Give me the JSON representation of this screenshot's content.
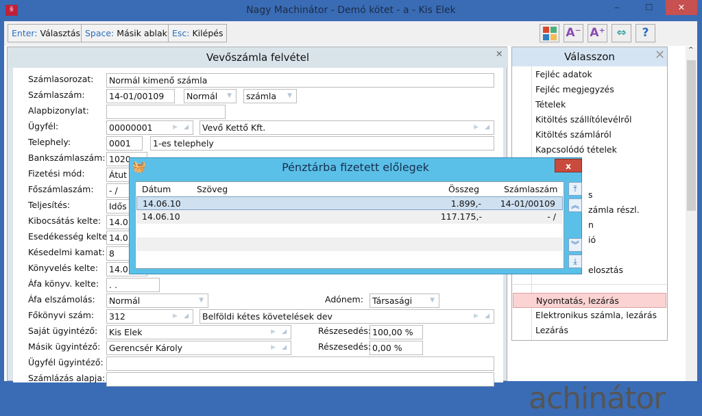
{
  "window": {
    "title": "Nagy Machinátor - Demó kötet - a - Kis Elek",
    "minimize": "‒",
    "maximize": "☐",
    "close": "✕"
  },
  "toolbar": {
    "buttons": [
      {
        "key": "Enter:",
        "label": "Választás"
      },
      {
        "key": "Space:",
        "label": "Másik ablak"
      },
      {
        "key": "Esc:",
        "label": "Kilépés"
      }
    ],
    "icons": [
      "tiles-icon",
      "font-decrease-icon",
      "font-increase-icon",
      "resize-icon",
      "help-icon"
    ],
    "icon_glyphs": [
      "",
      "A⁻",
      "A⁺",
      "⇔",
      "?"
    ]
  },
  "form": {
    "title": "Vevőszámla felvétel",
    "labels": [
      "Számlasorozat:",
      "Számlaszám:",
      "Alapbizonylat:",
      "Ügyfél:",
      "Telephely:",
      "Bankszámlaszám:",
      "Fizetési mód:",
      "Főszámlaszám:",
      "Teljesítés:",
      "Kibocsátás kelte:",
      "Esedékesség kelte:",
      "Késedelmi kamat:",
      "Könyvelés kelte:",
      "Áfa könyv. kelte:",
      "Áfa elszámolás:",
      "Főkönyvi szám:",
      "Saját ügyintéző:",
      "Másik ügyintéző:",
      "Ügyfél ügyintéző:",
      "Számlázás alapja:"
    ],
    "szamlasorozat": "Normál kimenő számla",
    "szamlaszam": "14-01/00109",
    "tipus": "Normál",
    "fajta": "számla",
    "alapbizonylat": "",
    "ugyfel_kod": "00000001",
    "ugyfel_nev": "Vevő Kettő Kft.",
    "telephely_kod": "0001",
    "telephely_nev": "1-es telephely",
    "bankszamla": "1020",
    "fizetesi_mod": "Átut",
    "foszamlaszam": "-  /",
    "teljesites": "Idős",
    "kibocsatas": "14.0",
    "esedekesseg": "14.0",
    "kamat": "8",
    "konyveles": "14.0",
    "afa_konyv": ". .",
    "afa_elszamolas": "Normál",
    "adonem_label": "Adónem:",
    "adonem": "Társasági",
    "fokonyv_kod": "312",
    "fokonyv_nev": "Belföldi kétes követelések  dev",
    "sajat": "Kis Elek",
    "reszesedes_label": "Részesedés:",
    "sajat_resz": "100,00 %",
    "masik": "Gerencsér Károly",
    "masik_resz": "0,00 %",
    "ugyfel_ugyintezo": "",
    "szamlazas_alapja": ""
  },
  "side": {
    "title": "Válasszon",
    "items": [
      "Fejléc adatok",
      "Fejléc megjegyzés",
      "Tételek",
      "Kitöltés szállítólevélről",
      "Kitöltés számláról",
      "Kapcsolódó tételek",
      "",
      "",
      "s",
      "zámla részl.",
      "n",
      "ió",
      "",
      "elosztás"
    ],
    "bottom_items": [
      "Nyomtatás, lezárás",
      "Elektronikus számla, lezárás",
      "Lezárás"
    ],
    "highlight_color": "#fbd3d3"
  },
  "dialog": {
    "title": "Pénztárba fizetett előlegek",
    "close": "x",
    "columns": [
      "Dátum",
      "Szöveg",
      "Összeg",
      "Számlaszám"
    ],
    "rows": [
      {
        "datum": "14.06.10",
        "szoveg": "",
        "osszeg": "1.899,-",
        "szamla": "14-01/00109",
        "selected": true
      },
      {
        "datum": "14.06.10",
        "szoveg": "",
        "osszeg": "117.175,-",
        "szamla": "-  /"
      }
    ],
    "nav": [
      "⤒",
      "︽",
      "︾",
      "⤓"
    ]
  },
  "brand": "achinátor"
}
